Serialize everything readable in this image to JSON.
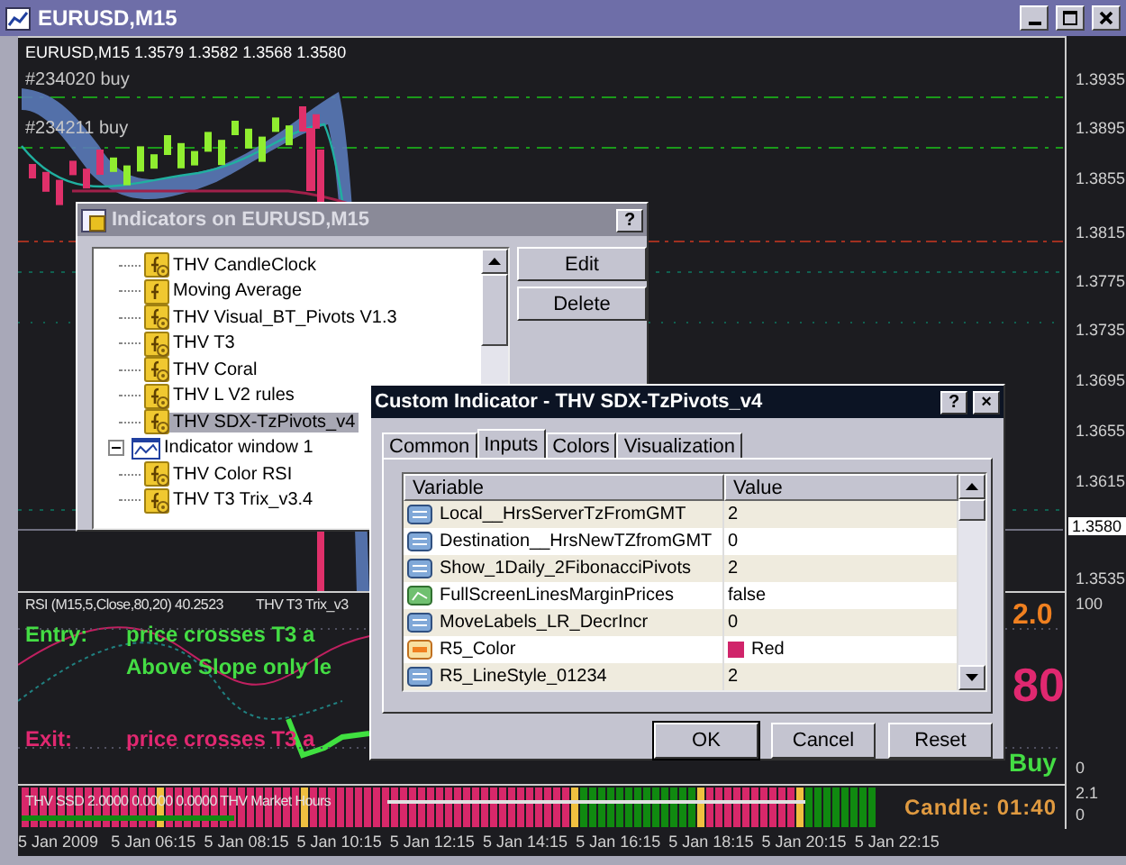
{
  "window": {
    "title": "EURUSD,M15"
  },
  "main_chart": {
    "info": "EURUSD,M15  1.3579 1.3582 1.3568 1.3580",
    "order_labels": [
      "#234020 buy",
      "#234211 buy"
    ],
    "price_ticks": [
      "1.3935",
      "1.3895",
      "1.3855",
      "1.3815",
      "1.3775",
      "1.3735",
      "1.3695",
      "1.3655",
      "1.3615",
      "1.3535"
    ],
    "current_price": "1.3580"
  },
  "rsi_pane": {
    "legend": [
      "RSI (M15,5,Close,80,20) 40.2523",
      "THV T3 Trix_v3"
    ],
    "signals": [
      {
        "kind": "entry",
        "label": "Entry:",
        "lines": [
          "price crosses T3 a",
          "Above Slope only le"
        ]
      },
      {
        "kind": "exit",
        "label": "Exit:",
        "lines": [
          "price crosses T3 a"
        ]
      }
    ],
    "readouts": [
      {
        "kind": "version",
        "text": "2.0"
      },
      {
        "kind": "level",
        "text": "80"
      },
      {
        "kind": "signal",
        "text": "Buy"
      }
    ],
    "axis": [
      "100",
      "0"
    ]
  },
  "ssd_pane": {
    "legend": "THV SSD 2.0000 0.0000 0.0000  THV Market Hours",
    "candle_timer": "Candle:  01:40",
    "axis": [
      "2.1",
      "0"
    ]
  },
  "time_axis": [
    "5 Jan 2009",
    "5 Jan 06:15",
    "5 Jan 08:15",
    "5 Jan 10:15",
    "5 Jan 12:15",
    "5 Jan 14:15",
    "5 Jan 16:15",
    "5 Jan 18:15",
    "5 Jan 20:15",
    "5 Jan 22:15"
  ],
  "indicators_dialog": {
    "title": "Indicators on EURUSD,M15",
    "title_buttons": [
      "?"
    ],
    "tree": [
      {
        "kind": "group",
        "children": [
          {
            "kind": "custom",
            "label": "THV CandleClock",
            "selected": false
          },
          {
            "kind": "builtin",
            "label": "Moving Average",
            "selected": false
          },
          {
            "kind": "custom",
            "label": "THV Visual_BT_Pivots V1.3",
            "selected": false
          },
          {
            "kind": "custom",
            "label": "THV T3",
            "selected": false
          },
          {
            "kind": "custom",
            "label": "THV Coral",
            "selected": false
          },
          {
            "kind": "custom",
            "label": "THV L  V2 rules",
            "selected": false
          },
          {
            "kind": "custom",
            "label": "THV SDX-TzPivots_v4",
            "selected": true
          }
        ]
      },
      {
        "kind": "window",
        "label": "Indicator window 1",
        "selected": false,
        "expanded": true,
        "children": [
          {
            "kind": "custom",
            "label": "THV Color RSI",
            "selected": false
          },
          {
            "kind": "custom",
            "label": "THV T3 Trix_v3.4",
            "selected": false
          }
        ]
      }
    ],
    "buttons": [
      "Edit",
      "Delete"
    ]
  },
  "custom_dialog": {
    "title": "Custom Indicator - THV SDX-TzPivots_v4",
    "title_buttons": [
      "?",
      "×"
    ],
    "tabs": [
      {
        "label": "Common",
        "selected": false
      },
      {
        "label": "Inputs",
        "selected": true
      },
      {
        "label": "Colors",
        "selected": false
      },
      {
        "label": "Visualization",
        "selected": false
      }
    ],
    "table": {
      "columns": [
        "Variable",
        "Value"
      ],
      "rows": [
        {
          "kind": "int",
          "variable": "Local__HrsServerTzFromGMT",
          "value": "2"
        },
        {
          "kind": "int",
          "variable": "Destination__HrsNewTZfromGMT",
          "value": "0"
        },
        {
          "kind": "int",
          "variable": "Show_1Daily_2FibonacciPivots",
          "value": "2"
        },
        {
          "kind": "bool",
          "variable": "FullScreenLinesMarginPrices",
          "value": "false"
        },
        {
          "kind": "int",
          "variable": "MoveLabels_LR_DecrIncr",
          "value": "0"
        },
        {
          "kind": "color",
          "variable": "R5_Color",
          "value": "Red",
          "color": "#d0246a"
        },
        {
          "kind": "int",
          "variable": "R5_LineStyle_01234",
          "value": "2"
        }
      ]
    },
    "buttons": [
      {
        "label": "OK",
        "default": true
      },
      {
        "label": "Cancel",
        "default": false
      },
      {
        "label": "Reset",
        "default": false
      }
    ]
  }
}
